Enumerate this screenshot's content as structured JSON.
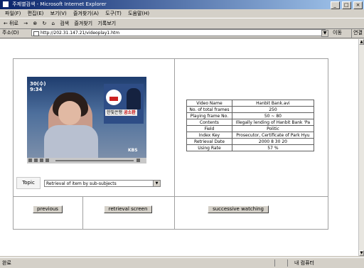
{
  "window": {
    "title": "주제별검색 - Microsoft Internet Explorer",
    "controls": [
      "_",
      "□",
      "×"
    ]
  },
  "menu": [
    "파일(F)",
    "편집(E)",
    "보기(V)",
    "즐겨찾기(A)",
    "도구(T)",
    "도움말(H)"
  ],
  "toolbar": {
    "back": "← 뒤로",
    "forward": "→",
    "stop": "⊗",
    "refresh": "↻",
    "home": "⌂",
    "search": "검색",
    "favorites": "즐겨찾기",
    "history": "기록보기"
  },
  "address": {
    "label": "주소(D)",
    "url": "http://202.31.147.21/videoplay1.htm",
    "go": "이동",
    "links": "연결"
  },
  "video": {
    "osd_line1": "30(수)",
    "osd_line2": "9:34",
    "caption_name": "공소환",
    "caption_prefix": "한빛은행",
    "channel": "KBS"
  },
  "topic": {
    "label": "Topic",
    "selected": "Retrieval of item by sub-subjects"
  },
  "info_table": [
    {
      "key": "Video Name",
      "value": "Hanbit Bank.avi"
    },
    {
      "key": "No. of total frames",
      "value": "250"
    },
    {
      "key": "Playing frame No.",
      "value": "50 ~ 80"
    },
    {
      "key": "Contents",
      "value": "Illegally lending of Hanbit Bank 'Pa"
    },
    {
      "key": "Field",
      "value": "Politic"
    },
    {
      "key": "Index Key",
      "value": "Prosecutor, Certificate of Park Hyu"
    },
    {
      "key": "Retrieval Date",
      "value": "2000   8   30   20"
    },
    {
      "key": "Using Rate",
      "value": "57 %"
    }
  ],
  "buttons": {
    "previous": "previous",
    "retrieval": "retrieval screen",
    "successive": "successive watching"
  },
  "status": {
    "left": "완료",
    "zone": "내 컴퓨터"
  }
}
